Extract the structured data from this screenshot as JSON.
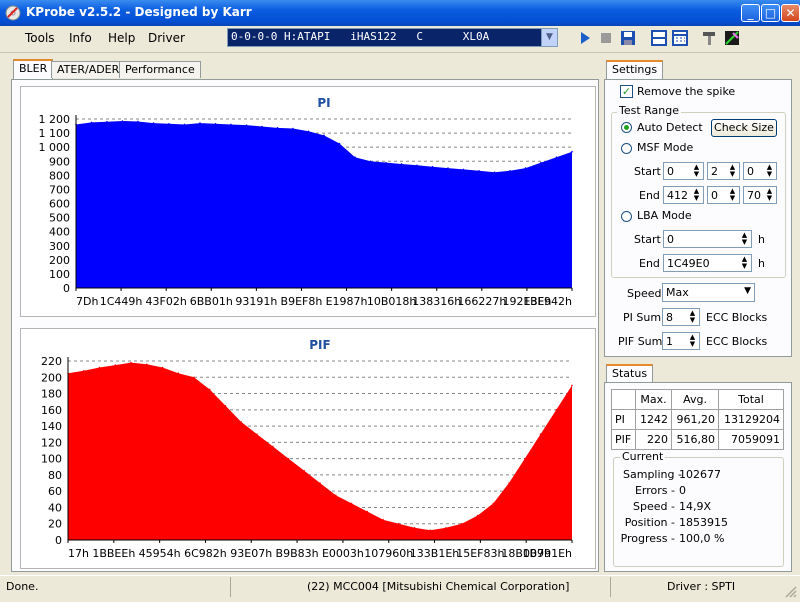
{
  "window": {
    "title": "KProbe v2.5.2 - Designed by Karr"
  },
  "menu": {
    "items": [
      "Tools",
      "Info",
      "Help",
      "Driver"
    ]
  },
  "toolbar": {
    "drive_selected": "0-0-0-0 H:ATAPI   iHAS122   C      XL0A",
    "icons": [
      "play-icon",
      "stop-icon",
      "save-icon",
      "layout-icon",
      "calculator-icon",
      "tools-icon",
      "disc-scan-icon"
    ]
  },
  "tabs": [
    "BLER",
    "ATER/ADER",
    "Performance"
  ],
  "colors": {
    "pi": "#0000ff",
    "pif": "#ff0000",
    "accent": "#e68b2c"
  },
  "chart_data": [
    {
      "type": "area",
      "title": "PI",
      "ylim": [
        0,
        1240
      ],
      "yticks": [
        0,
        100,
        200,
        300,
        400,
        500,
        600,
        700,
        800,
        900,
        "1 000",
        "1 100",
        "1 200"
      ],
      "xtick_labels": [
        "7Dh",
        "1C449h",
        "43F02h",
        "6BB01h",
        "93191h",
        "B9EF8h",
        "E1987h",
        "10B018h",
        "138316h",
        "166227h",
        "192E3Eh",
        "1BF942h"
      ],
      "series": [
        {
          "name": "PI",
          "color": "#0000ff",
          "values": [
            1200,
            1215,
            1220,
            1225,
            1222,
            1210,
            1205,
            1200,
            1210,
            1205,
            1200,
            1195,
            1185,
            1175,
            1170,
            1150,
            1120,
            1060,
            960,
            930,
            920,
            910,
            900,
            890,
            880,
            870,
            860,
            850,
            860,
            880,
            920,
            960,
            1000
          ]
        }
      ],
      "grid": true
    },
    {
      "type": "area",
      "title": "PIF",
      "ylim": [
        0,
        220
      ],
      "yticks": [
        0,
        20,
        40,
        60,
        80,
        100,
        120,
        140,
        160,
        180,
        200,
        220
      ],
      "xtick_labels": [
        "17h",
        "1BBEEh",
        "45954h",
        "6C982h",
        "93E07h",
        "B9B83h",
        "E0003h",
        "107960h",
        "133B1Eh",
        "15EF83h",
        "18B009h",
        "1B791Eh"
      ],
      "series": [
        {
          "name": "PIF",
          "color": "#ff0000",
          "values": [
            205,
            208,
            212,
            215,
            218,
            216,
            212,
            205,
            200,
            185,
            165,
            145,
            130,
            115,
            100,
            85,
            70,
            55,
            45,
            35,
            25,
            20,
            15,
            12,
            15,
            20,
            30,
            45,
            70,
            100,
            130,
            160,
            190
          ]
        }
      ],
      "grid": true
    }
  ],
  "settings": {
    "tab_label": "Settings",
    "remove_spike": {
      "label": "Remove the spike",
      "checked": true
    },
    "test_range_label": "Test Range",
    "auto_detect": "Auto Detect",
    "check_size": "Check Size",
    "msf_mode": "MSF Mode",
    "start_label": "Start",
    "end_label": "End",
    "msf_start": [
      "0",
      "2",
      "0"
    ],
    "msf_end": [
      "412",
      "0",
      "70"
    ],
    "lba_mode": "LBA Mode",
    "lba_start": "0",
    "lba_end": "1C49E0",
    "hex_suffix": "h",
    "speed_label": "Speed",
    "speed_value": "Max",
    "pi_sum_label": "PI Sum",
    "pi_sum_value": "8",
    "pif_sum_label": "PIF Sum",
    "pif_sum_value": "1",
    "ecc_blocks": "ECC Blocks"
  },
  "status": {
    "tab_label": "Status",
    "headers": [
      "",
      "Max.",
      "Avg.",
      "Total"
    ],
    "rows": [
      [
        "PI",
        "1242",
        "961,20",
        "13129204"
      ],
      [
        "PIF",
        "220",
        "516,80",
        "7059091"
      ]
    ],
    "current_label": "Current",
    "sampling_label": "Sampling -",
    "sampling": "102677",
    "errors_label": "Errors -",
    "errors": "0",
    "speed_label": "Speed -",
    "speed": "14,9X",
    "position_label": "Position -",
    "position": "1853915",
    "progress_label": "Progress -",
    "progress": "100,0 %"
  },
  "statusbar": {
    "left": "Done.",
    "center": "(22) MCC004 [Mitsubishi Chemical Corporation]",
    "right": "Driver : SPTI"
  }
}
